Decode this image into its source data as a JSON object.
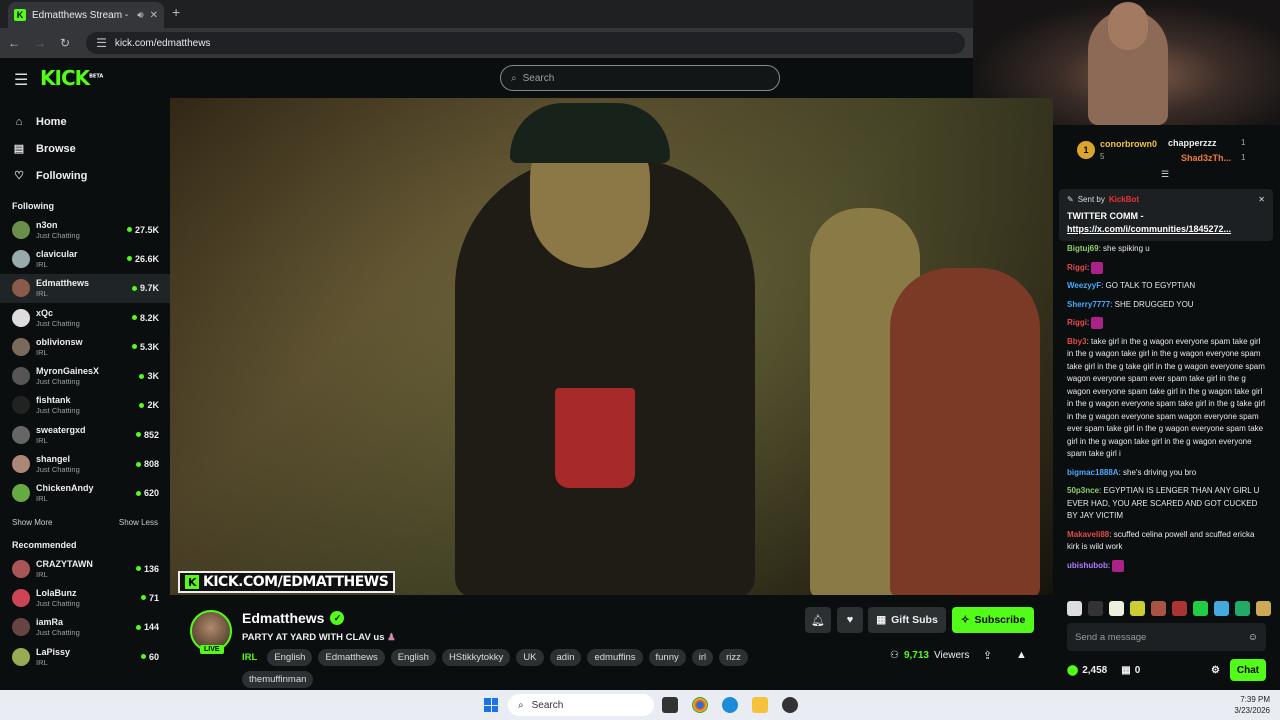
{
  "browser": {
    "tab_title": "Edmatthews Stream - Watc",
    "url": "kick.com/edmatthews",
    "new_tab": "+"
  },
  "header": {
    "logo": "KICK",
    "logo_badge": "BETA",
    "search_placeholder": "Search"
  },
  "nav": [
    {
      "label": "Home",
      "icon": "home-icon",
      "glyph": "⌂"
    },
    {
      "label": "Browse",
      "icon": "browse-icon",
      "glyph": "▤"
    },
    {
      "label": "Following",
      "icon": "heart-icon",
      "glyph": "♡"
    }
  ],
  "following_title": "Following",
  "following": [
    {
      "name": "n3on",
      "category": "Just Chatting",
      "viewers": "27.5K",
      "color": "#6a8f4a"
    },
    {
      "name": "clavicular",
      "category": "IRL",
      "viewers": "26.6K",
      "color": "#9aa"
    },
    {
      "name": "Edmatthews",
      "category": "IRL",
      "viewers": "9.7K",
      "color": "#8a5a4a"
    },
    {
      "name": "xQc",
      "category": "Just Chatting",
      "viewers": "8.2K",
      "color": "#ddd"
    },
    {
      "name": "oblivionsw",
      "category": "IRL",
      "viewers": "5.3K",
      "color": "#7a6a5a"
    },
    {
      "name": "MyronGainesX",
      "category": "Just Chatting",
      "viewers": "3K",
      "color": "#555"
    },
    {
      "name": "fishtank",
      "category": "Just Chatting",
      "viewers": "2K",
      "color": "#222"
    },
    {
      "name": "sweatergxd",
      "category": "IRL",
      "viewers": "852",
      "color": "#666"
    },
    {
      "name": "shangel",
      "category": "Just Chatting",
      "viewers": "808",
      "color": "#a87"
    },
    {
      "name": "ChickenAndy",
      "category": "IRL",
      "viewers": "620",
      "color": "#6a4"
    }
  ],
  "show_more": "Show More",
  "show_less": "Show Less",
  "recommended_title": "Recommended",
  "recommended": [
    {
      "name": "CRAZYTAWN",
      "category": "IRL",
      "viewers": "136",
      "color": "#a55"
    },
    {
      "name": "LolaBunz",
      "category": "Just Chatting",
      "viewers": "71",
      "color": "#c45"
    },
    {
      "name": "iamRa",
      "category": "Just Chatting",
      "viewers": "144",
      "color": "#644"
    },
    {
      "name": "LaPissy",
      "category": "IRL",
      "viewers": "60",
      "color": "#9a5"
    }
  ],
  "video": {
    "watermark": "KICK.COM/EDMATTHEWS"
  },
  "stream": {
    "streamer": "Edmatthews",
    "live": "LIVE",
    "title": "PARTY AT YARD WITH CLAV us",
    "category": "IRL",
    "tags": [
      "English",
      "Edmatthews",
      "English",
      "HStikkytokky",
      "UK",
      "adin",
      "edmuffins",
      "funny",
      "irl",
      "rizz",
      "themuffinman"
    ],
    "gift_subs": "Gift Subs",
    "subscribe": "Subscribe",
    "viewers": "9,713",
    "viewers_label": "Viewers"
  },
  "chat": {
    "leader1_rank": "1",
    "leader1_name": "conorbrown0",
    "leader1_count": "5",
    "leader2_name": "chapperzzz",
    "leader2_count": "1",
    "leader3_name": "Shad3zTh...",
    "leader3_count": "1",
    "pinned_by": "Sent by",
    "pinned_sender": "KickBot",
    "pinned_text": "TWITTER COMM -",
    "pinned_link": "https://x.com/i/communities/1845272...",
    "messages": [
      {
        "user": "Bigtuj69",
        "color": "#8fd06a",
        "text": "she spiking u"
      },
      {
        "user": "Riggi",
        "color": "#e24a4a",
        "text": ""
      },
      {
        "user": "WeezyyF",
        "color": "#4aa8ff",
        "text": "GO TALK TO EGYPTIAN"
      },
      {
        "user": "Sherry7777",
        "color": "#4aa8ff",
        "text": "SHE DRUGGED YOU"
      },
      {
        "user": "Riggi",
        "color": "#e24a4a",
        "text": ""
      },
      {
        "user": "Bby3",
        "color": "#e24a4a",
        "text": "take girl in the g wagon everyone spam take girl in the g wagon take girl in the g wagon everyone spam take girl in the g take girl in the g wagon everyone spam wagon everyone spam ever spam take girl in the g wagon everyone spam take girl in the g wagon take girl in the g wagon everyone spam take girl in the g take girl in the g wagon everyone spam wagon everyone spam ever spam take girl in the g wagon everyone spam take girl in the g wagon take girl in the g wagon everyone spam take girl i"
      },
      {
        "user": "bigmac1888A",
        "color": "#4aa8ff",
        "text": "she's driving you bro"
      },
      {
        "user": "50p3nce",
        "color": "#8fd06a",
        "text": "EGYPTIAN IS LENGER THAN ANY GIRL U EVER HAD, YOU ARE SCARED AND GOT CUCKED BY JAY VICTIM"
      },
      {
        "user": "Makaveli88",
        "color": "#e24a4a",
        "text": "scuffed celina powell and scuffed ericka kirk is wild work"
      },
      {
        "user": "ubishubob",
        "color": "#b27aff",
        "text": ""
      }
    ],
    "input_placeholder": "Send a message",
    "points": "2,458",
    "gifts": "0",
    "send": "Chat"
  },
  "taskbar": {
    "search": "Search",
    "time": "7:39 PM",
    "date": "3/23/2026"
  }
}
